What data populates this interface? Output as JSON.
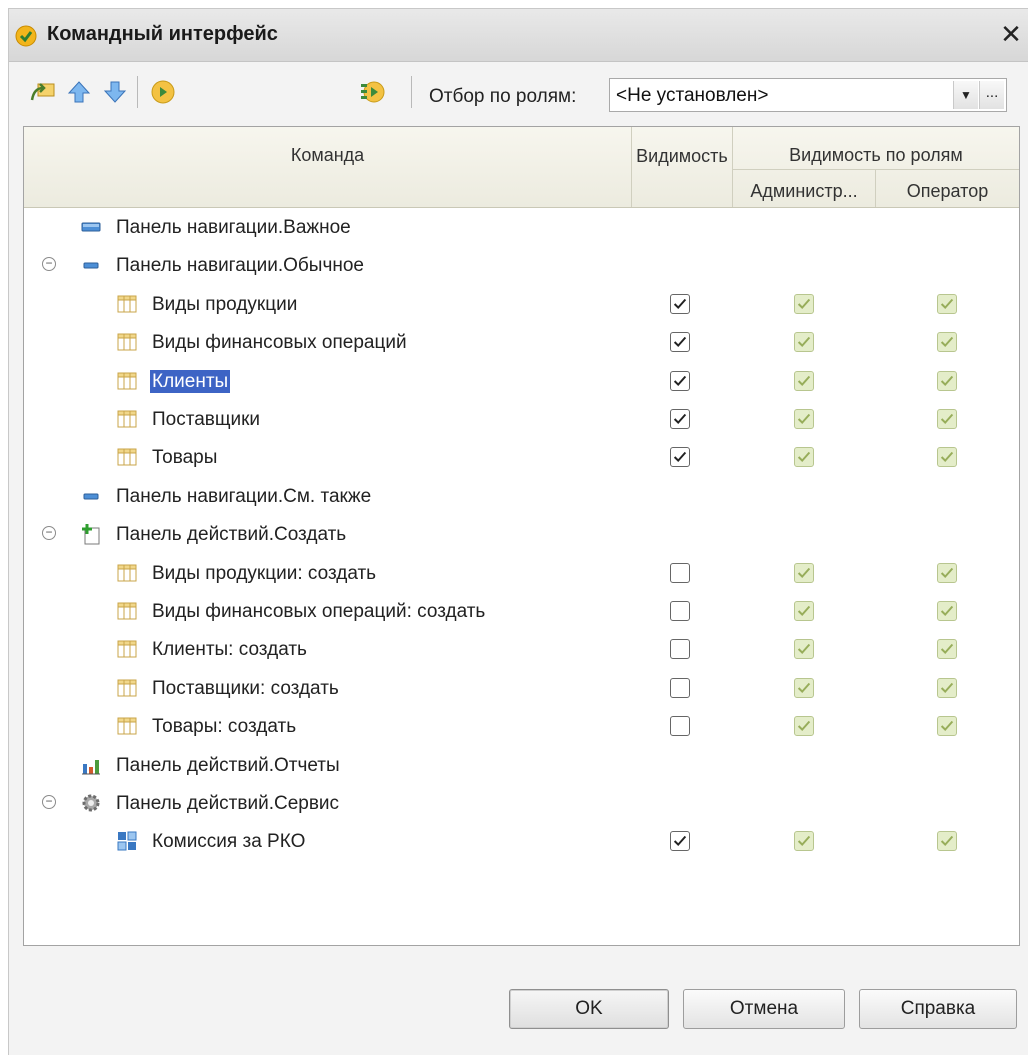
{
  "window": {
    "title": "Командный интерфейс",
    "close": "✕"
  },
  "toolbar": {
    "filter_label": "Отбор по ролям:",
    "filter_value": "<Не установлен>",
    "filter_more": "..."
  },
  "grid": {
    "col_command": "Команда",
    "col_visibility": "Видимость",
    "col_visibility_roles": "Видимость по ролям",
    "col_role1": "Администр...",
    "col_role2": "Оператор"
  },
  "rows": [
    {
      "label": "Панель навигации.Важное",
      "level": 0,
      "icon": "panel-important-icon",
      "toggle": ""
    },
    {
      "label": "Панель навигации.Обычное",
      "level": 0,
      "icon": "panel-normal-icon",
      "toggle": "−"
    },
    {
      "label": "Виды продукции",
      "level": 1,
      "icon": "catalog-icon",
      "visible": true,
      "role1": true,
      "role2": true
    },
    {
      "label": "Виды финансовых операций",
      "level": 1,
      "icon": "catalog-icon",
      "visible": true,
      "role1": true,
      "role2": true
    },
    {
      "label": "Клиенты",
      "level": 1,
      "icon": "catalog-icon",
      "visible": true,
      "role1": true,
      "role2": true,
      "selected": true
    },
    {
      "label": "Поставщики",
      "level": 1,
      "icon": "catalog-icon",
      "visible": true,
      "role1": true,
      "role2": true
    },
    {
      "label": "Товары",
      "level": 1,
      "icon": "catalog-icon",
      "visible": true,
      "role1": true,
      "role2": true
    },
    {
      "label": "Панель навигации.См. также",
      "level": 0,
      "icon": "panel-normal-icon",
      "toggle": ""
    },
    {
      "label": "Панель действий.Создать",
      "level": 0,
      "icon": "create-document-icon",
      "toggle": "−"
    },
    {
      "label": "Виды продукции: создать",
      "level": 1,
      "icon": "catalog-icon",
      "visible": false,
      "role1": true,
      "role2": true
    },
    {
      "label": "Виды финансовых операций: создать",
      "level": 1,
      "icon": "catalog-icon",
      "visible": false,
      "role1": true,
      "role2": true
    },
    {
      "label": "Клиенты: создать",
      "level": 1,
      "icon": "catalog-icon",
      "visible": false,
      "role1": true,
      "role2": true
    },
    {
      "label": "Поставщики: создать",
      "level": 1,
      "icon": "catalog-icon",
      "visible": false,
      "role1": true,
      "role2": true
    },
    {
      "label": "Товары: создать",
      "level": 1,
      "icon": "catalog-icon",
      "visible": false,
      "role1": true,
      "role2": true
    },
    {
      "label": "Панель действий.Отчеты",
      "level": 0,
      "icon": "reports-chart-icon",
      "toggle": ""
    },
    {
      "label": "Панель действий.Сервис",
      "level": 0,
      "icon": "service-gear-icon",
      "toggle": "−"
    },
    {
      "label": "Комиссия за РКО",
      "level": 1,
      "icon": "data-processor-icon",
      "visible": true,
      "role1": true,
      "role2": true
    }
  ],
  "buttons": {
    "ok": "OK",
    "cancel": "Отмена",
    "help": "Справка"
  },
  "colors": {
    "selection": "#3d64c5",
    "readonly_check_bg": "#e4edc9",
    "header_bg": "#f3f2e7"
  }
}
